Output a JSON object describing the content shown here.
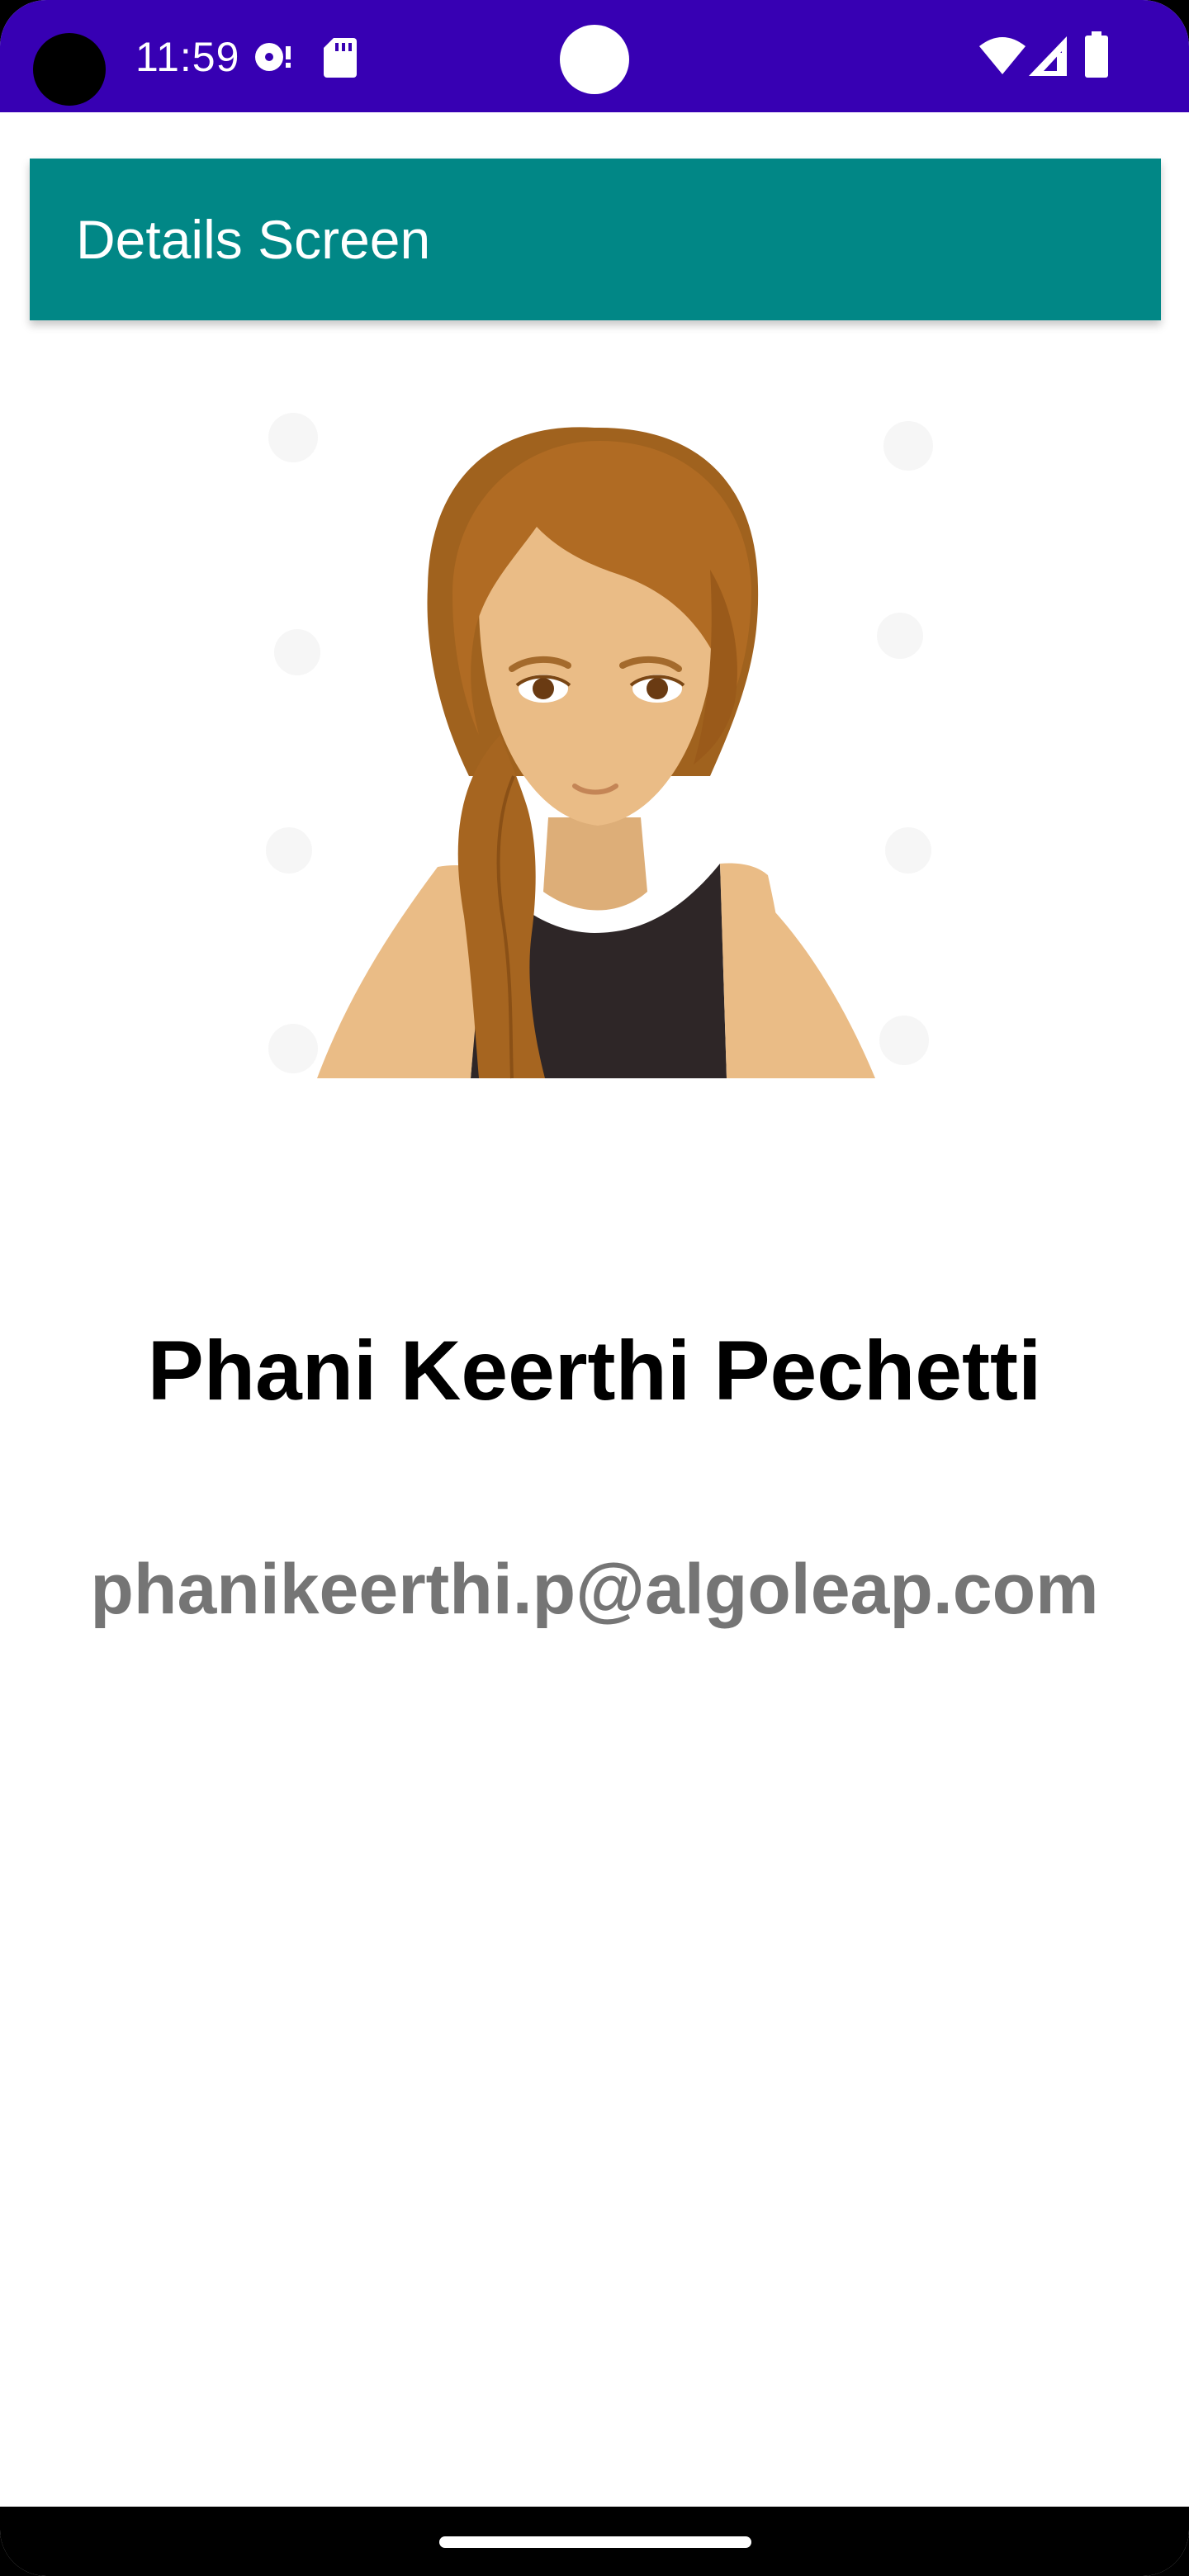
{
  "status_bar": {
    "time": "11:59",
    "background_color": "#3700b3",
    "left_icons": [
      "media-disc-icon",
      "sd-card-icon"
    ],
    "right_icons": [
      "wifi-icon",
      "cell-signal-icon",
      "battery-icon"
    ]
  },
  "app_bar": {
    "title": "Details Screen",
    "background_color": "#018786"
  },
  "profile": {
    "image_icon": "woman-avatar-illustration",
    "name": "Phani Keerthi Pechetti",
    "email": "phanikeerthi.p@algoleap.com",
    "email_color": "#757575"
  },
  "navigation_bar": {
    "handle": "home-gesture-handle"
  }
}
